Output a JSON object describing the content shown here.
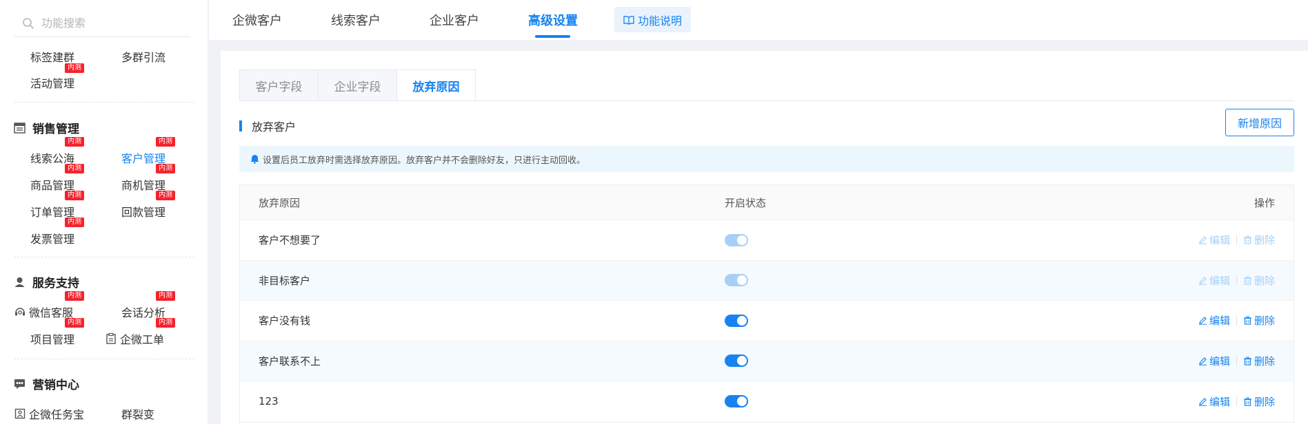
{
  "search": {
    "placeholder": "功能搜索"
  },
  "sidebar": {
    "items": {
      "tag_group": {
        "label": "标签建群"
      },
      "multi_group": {
        "label": "多群引流"
      },
      "activity": {
        "label": "活动管理",
        "badge": "内测"
      },
      "sales_title": "销售管理",
      "leads_pool": {
        "label": "线索公海",
        "badge": "内测"
      },
      "customer_mgmt": {
        "label": "客户管理",
        "badge": "内测"
      },
      "product_mgmt": {
        "label": "商品管理",
        "badge": "内测"
      },
      "opportunity_mgmt": {
        "label": "商机管理",
        "badge": "内测"
      },
      "order_mgmt": {
        "label": "订单管理",
        "badge": "内测"
      },
      "payment_mgmt": {
        "label": "回款管理",
        "badge": "内测"
      },
      "invoice_mgmt": {
        "label": "发票管理",
        "badge": "内测"
      },
      "service_title": "服务支持",
      "wechat_service": {
        "label": "微信客服",
        "badge": "内测"
      },
      "session_analysis": {
        "label": "会话分析",
        "badge": "内测"
      },
      "project_mgmt": {
        "label": "项目管理",
        "badge": "内测"
      },
      "work_order": {
        "label": "企微工单"
      },
      "marketing_title": "营销中心",
      "task_treasure": {
        "label": "企微任务宝"
      },
      "fission": {
        "label": "群裂变"
      }
    }
  },
  "top_tabs": [
    "企微客户",
    "线索客户",
    "企业客户",
    "高级设置"
  ],
  "help_button": "功能说明",
  "sub_tabs": [
    "客户字段",
    "企业字段",
    "放弃原因"
  ],
  "section": {
    "title": "放弃客户",
    "add_button": "新增原因"
  },
  "notice": "设置后员工放弃时需选择放弃原因。放弃客户并不会删除好友，只进行主动回收。",
  "table": {
    "headers": {
      "reason": "放弃原因",
      "status": "开启状态",
      "ops": "操作"
    },
    "rows": [
      {
        "reason": "客户不想要了",
        "enabled": true,
        "locked": true
      },
      {
        "reason": "非目标客户",
        "enabled": true,
        "locked": true
      },
      {
        "reason": "客户没有钱",
        "enabled": true,
        "locked": false
      },
      {
        "reason": "客户联系不上",
        "enabled": true,
        "locked": false
      },
      {
        "reason": "123",
        "enabled": true,
        "locked": false
      }
    ],
    "edit_label": "编辑",
    "delete_label": "删除"
  },
  "colors": {
    "accent": "#1683f0",
    "badge": "#f5222d",
    "notice_bg": "#ecf6fd"
  }
}
